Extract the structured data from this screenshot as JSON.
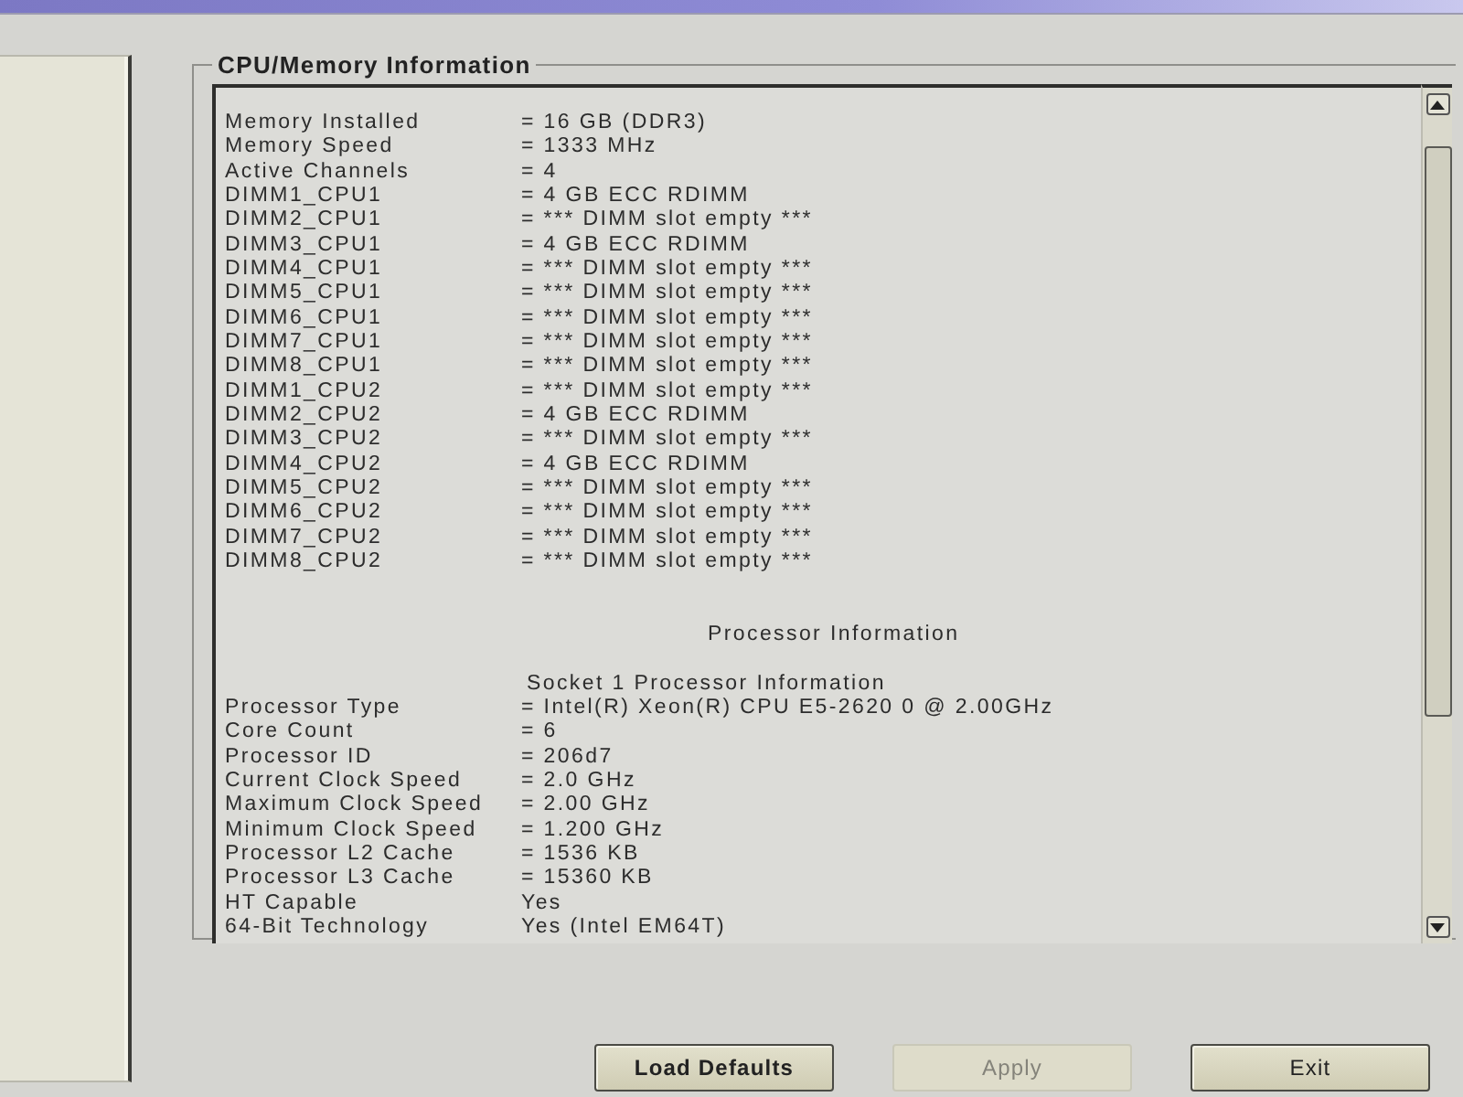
{
  "section": {
    "title": "CPU/Memory Information",
    "memory_rows": [
      {
        "label": "Memory Installed",
        "value": "= 16 GB (DDR3)"
      },
      {
        "label": "Memory Speed",
        "value": "= 1333 MHz"
      },
      {
        "label": "Active Channels",
        "value": "= 4"
      },
      {
        "label": "DIMM1_CPU1",
        "value": "= 4 GB ECC RDIMM"
      },
      {
        "label": "DIMM2_CPU1",
        "value": "= *** DIMM slot empty ***"
      },
      {
        "label": "DIMM3_CPU1",
        "value": "= 4 GB ECC RDIMM"
      },
      {
        "label": "DIMM4_CPU1",
        "value": "= *** DIMM slot empty ***"
      },
      {
        "label": "DIMM5_CPU1",
        "value": "= *** DIMM slot empty ***"
      },
      {
        "label": "DIMM6_CPU1",
        "value": "= *** DIMM slot empty ***"
      },
      {
        "label": "DIMM7_CPU1",
        "value": "= *** DIMM slot empty ***"
      },
      {
        "label": "DIMM8_CPU1",
        "value": "= *** DIMM slot empty ***"
      },
      {
        "label": "DIMM1_CPU2",
        "value": "= *** DIMM slot empty ***"
      },
      {
        "label": "DIMM2_CPU2",
        "value": "= 4 GB ECC RDIMM"
      },
      {
        "label": "DIMM3_CPU2",
        "value": "= *** DIMM slot empty ***"
      },
      {
        "label": "DIMM4_CPU2",
        "value": "= 4 GB ECC RDIMM"
      },
      {
        "label": "DIMM5_CPU2",
        "value": "= *** DIMM slot empty ***"
      },
      {
        "label": "DIMM6_CPU2",
        "value": "= *** DIMM slot empty ***"
      },
      {
        "label": "DIMM7_CPU2",
        "value": "= *** DIMM slot empty ***"
      },
      {
        "label": "DIMM8_CPU2",
        "value": "= *** DIMM slot empty ***"
      }
    ],
    "processor_title": "Processor Information",
    "socket_title": "Socket 1 Processor Information",
    "processor_rows": [
      {
        "label": "Processor Type",
        "value": "= Intel(R) Xeon(R) CPU E5-2620 0 @ 2.00GHz"
      },
      {
        "label": "Core Count",
        "value": "= 6"
      },
      {
        "label": "Processor ID",
        "value": "= 206d7"
      },
      {
        "label": "Current Clock Speed",
        "value": "= 2.0 GHz"
      },
      {
        "label": "Maximum Clock Speed",
        "value": "= 2.00 GHz"
      },
      {
        "label": "Minimum Clock Speed",
        "value": "= 1.200 GHz"
      },
      {
        "label": "Processor L2 Cache",
        "value": "= 1536 KB"
      },
      {
        "label": "Processor L3 Cache",
        "value": "= 15360 KB"
      },
      {
        "label": "HT Capable",
        "value": "Yes"
      },
      {
        "label": "64-Bit Technology",
        "value": "Yes (Intel EM64T)"
      }
    ]
  },
  "buttons": [
    {
      "label": "Load Defaults",
      "disabled": false
    },
    {
      "label": "Apply",
      "disabled": true
    },
    {
      "label": "Exit",
      "disabled": false
    }
  ]
}
